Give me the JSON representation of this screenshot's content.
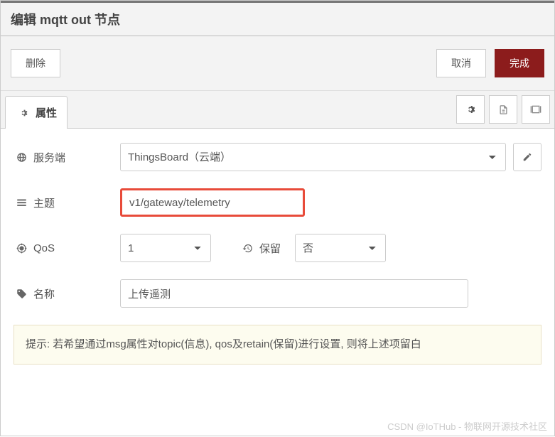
{
  "header": {
    "title": "编辑 mqtt out 节点"
  },
  "actions": {
    "delete": "删除",
    "cancel": "取消",
    "done": "完成"
  },
  "tabs": {
    "properties": "属性"
  },
  "form": {
    "server": {
      "label": "服务端",
      "value": "ThingsBoard（云端）"
    },
    "topic": {
      "label": "主题",
      "value": "v1/gateway/telemetry"
    },
    "qos": {
      "label": "QoS",
      "value": "1"
    },
    "retain": {
      "label": "保留",
      "value": "否"
    },
    "name": {
      "label": "名称",
      "value": "上传遥测"
    }
  },
  "hint": "提示: 若希望通过msg属性对topic(信息), qos及retain(保留)进行设置, 则将上述项留白",
  "watermark": "CSDN @IoTHub - 物联网开源技术社区"
}
